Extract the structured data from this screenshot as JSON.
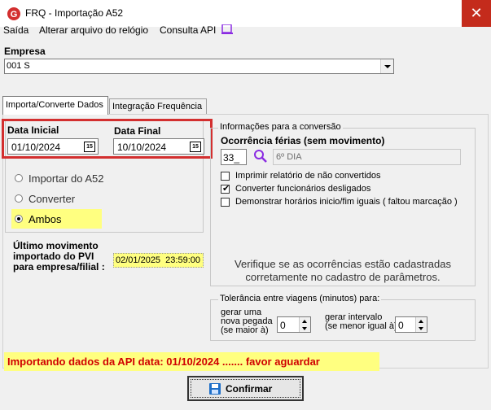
{
  "window": {
    "title": "FRQ - Importação A52",
    "close_glyph": "✕",
    "logo_letter": "G"
  },
  "menu": {
    "exit": "Saída",
    "change_file": "Alterar arquivo do relógio",
    "api_query": "Consulta API"
  },
  "company": {
    "label": "Empresa",
    "value": "001 S"
  },
  "tabs": [
    {
      "label": "Importa/Converte Dados"
    },
    {
      "label": "Integração Frequência"
    }
  ],
  "dates": {
    "start_label": "Data Inicial",
    "start_value": "01/10/2024",
    "end_label": "Data Final",
    "end_value": "10/10/2024",
    "calendar_text": "15"
  },
  "mode": {
    "options": [
      {
        "label": "Importar do A52",
        "selected": false
      },
      {
        "label": "Converter",
        "selected": false
      },
      {
        "label": "Ambos",
        "selected": true
      }
    ]
  },
  "last_movement": {
    "label_line1": "Último movimento",
    "label_line2": "importado do PVI",
    "label_line3": "para empresa/filial :",
    "value": "02/01/2025  23:59:00"
  },
  "conversion": {
    "group_title": "Informações para a conversão",
    "vacation_label": "Ocorrência férias (sem movimento)",
    "vacation_code": "33_",
    "vacation_desc": "6º DIA",
    "checks": [
      {
        "label": "Imprimir relatório de não convertidos",
        "checked": false
      },
      {
        "label": "Converter funcionários desligados",
        "checked": true
      },
      {
        "label": "Demonstrar horários inicio/fim iguais ( faltou marcação )",
        "checked": false
      }
    ],
    "notice_line1": "Verifique se as ocorrências estão cadastradas",
    "notice_line2": "corretamente  no cadastro de parâmetros."
  },
  "tolerance": {
    "group_title": "Tolerância entre viagens (minutos) para:",
    "new_pickup_l1": "gerar uma",
    "new_pickup_l2": "nova pegada",
    "new_pickup_l3": "(se maior à)",
    "new_pickup_value": "0",
    "interval_l1": "gerar intervalo",
    "interval_l2": "(se menor igual à)",
    "interval_value": "0"
  },
  "status": {
    "message": "Importando dados da API data: 01/10/2024 ....... favor aguardar"
  },
  "confirm": {
    "label": "Confirmar"
  },
  "colors": {
    "accent_red": "#d32f2f",
    "highlight_yellow": "#ffff80",
    "status_text": "#d00000"
  }
}
